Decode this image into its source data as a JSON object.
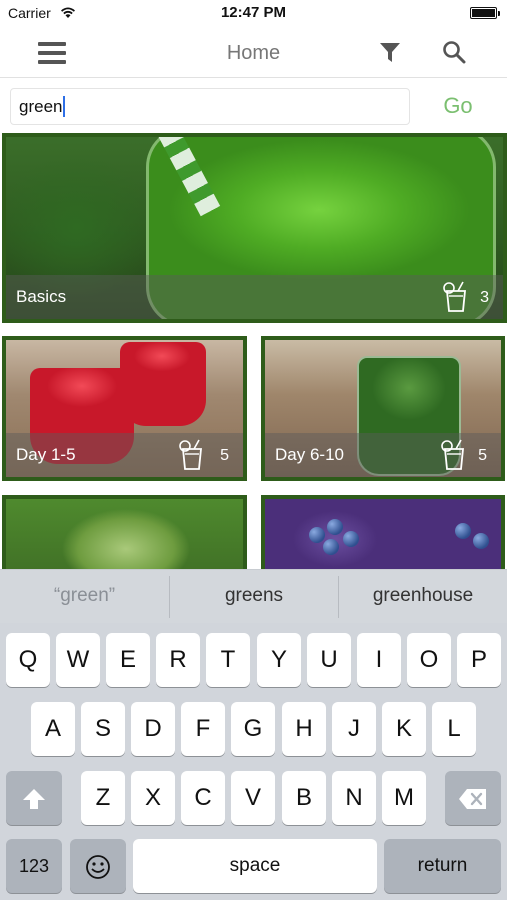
{
  "status_bar": {
    "carrier": "Carrier",
    "time": "12:47 PM"
  },
  "nav": {
    "title": "Home",
    "menu_icon": "hamburger-menu-icon",
    "filter_icon": "funnel-filter-icon",
    "search_icon": "magnifier-search-icon"
  },
  "search": {
    "value": "green",
    "go_label": "Go"
  },
  "accent_colors": {
    "go_text": "#7bbf70",
    "tile_border": "#2e5c1a"
  },
  "tiles": [
    {
      "label": "Basics",
      "count": "3",
      "icon": "smoothie-glass-icon"
    },
    {
      "label": "Day 1-5",
      "count": "5",
      "icon": "smoothie-glass-icon"
    },
    {
      "label": "Day 6-10",
      "count": "5",
      "icon": "smoothie-glass-icon"
    }
  ],
  "suggestions": [
    "“green”",
    "greens",
    "greenhouse"
  ],
  "keyboard": {
    "row1": [
      "Q",
      "W",
      "E",
      "R",
      "T",
      "Y",
      "U",
      "I",
      "O",
      "P"
    ],
    "row2": [
      "A",
      "S",
      "D",
      "F",
      "G",
      "H",
      "J",
      "K",
      "L"
    ],
    "row3": [
      "Z",
      "X",
      "C",
      "V",
      "B",
      "N",
      "M"
    ],
    "numbers_label": "123",
    "space_label": "space",
    "return_label": "return"
  }
}
